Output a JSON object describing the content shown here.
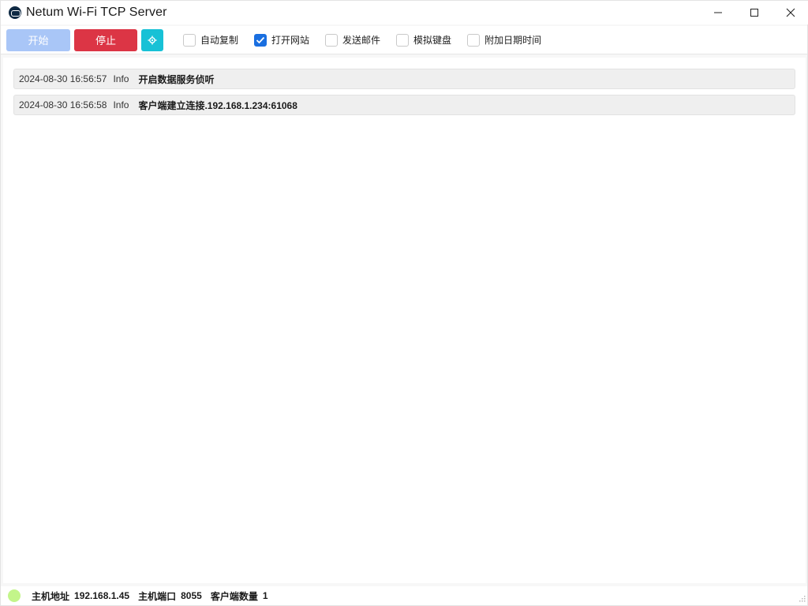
{
  "window": {
    "title": "Netum Wi-Fi TCP Server",
    "icon": "app-logo-icon",
    "controls": [
      "minimize-icon",
      "maximize-icon",
      "close-icon"
    ]
  },
  "toolbar": {
    "start_label": "开始",
    "stop_label": "停止",
    "settings_icon": "gear-icon",
    "checkboxes": [
      {
        "label": "自动复制",
        "checked": false
      },
      {
        "label": "打开网站",
        "checked": true
      },
      {
        "label": "发送邮件",
        "checked": false
      },
      {
        "label": "模拟键盘",
        "checked": false
      },
      {
        "label": "附加日期时间",
        "checked": false
      }
    ]
  },
  "log": {
    "entries": [
      {
        "time": "2024-08-30 16:56:57",
        "level": "Info",
        "message": "开启数据服务侦听"
      },
      {
        "time": "2024-08-30 16:56:58",
        "level": "Info",
        "message": "客户端建立连接.192.168.1.234:61068"
      }
    ]
  },
  "status": {
    "host_label": "主机地址",
    "host_value": "192.168.1.45",
    "port_label": "主机端口",
    "port_value": "8055",
    "clients_label": "客户端数量",
    "clients_value": "1",
    "indicator_color": "#c3f58a"
  },
  "colors": {
    "start": "#a9c6f7",
    "stop": "#dc3545",
    "settings": "#17c1d6",
    "checked": "#1a6fe0"
  }
}
